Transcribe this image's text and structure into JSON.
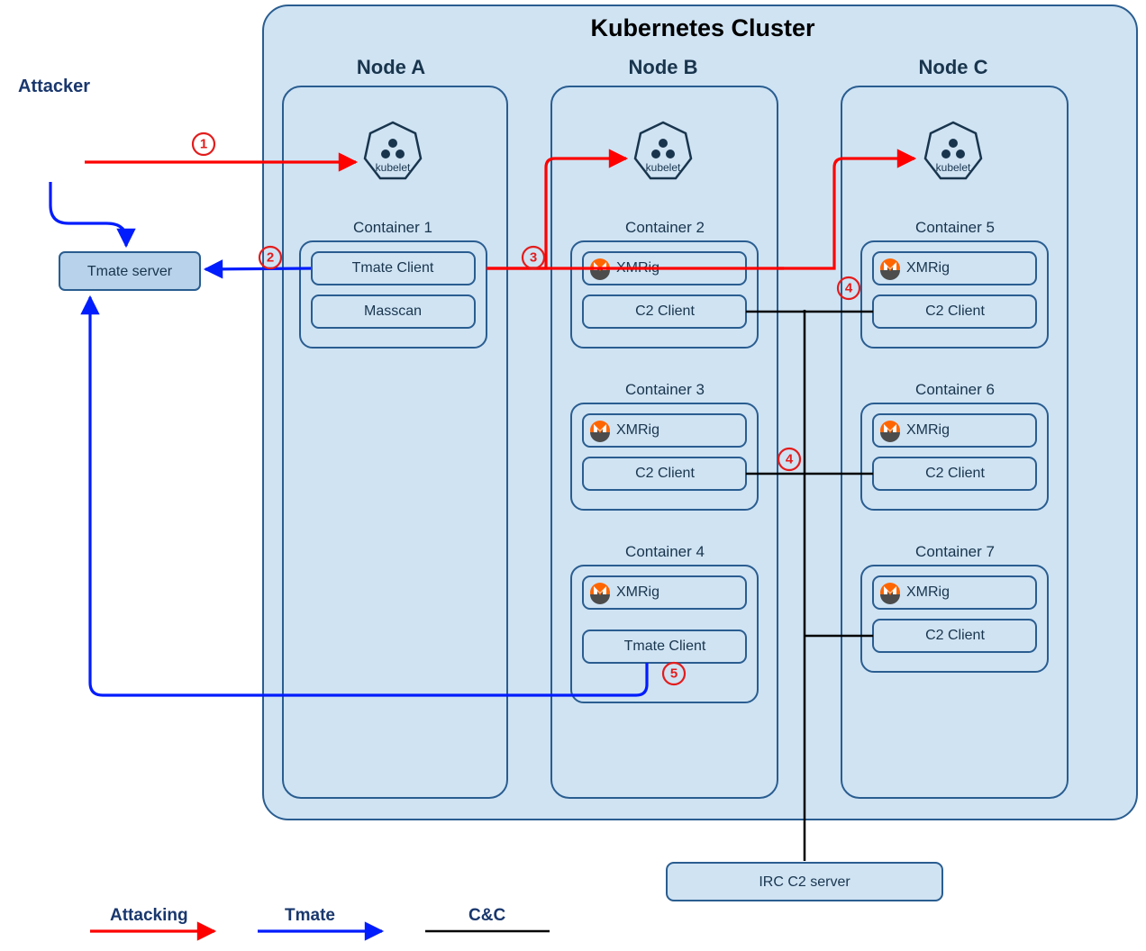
{
  "attacker": "Attacker",
  "cluster": {
    "title": "Kubernetes Cluster"
  },
  "kubelet_label": "kubelet",
  "tmate_server": "Tmate server",
  "irc_server": "IRC C2 server",
  "nodes": {
    "a": {
      "title": "Node A",
      "containers": [
        {
          "title": "Container 1",
          "items": [
            "Tmate Client",
            "Masscan"
          ]
        }
      ]
    },
    "b": {
      "title": "Node B",
      "containers": [
        {
          "title": "Container 2",
          "items": [
            "XMRig",
            "C2 Client"
          ]
        },
        {
          "title": "Container 3",
          "items": [
            "XMRig",
            "C2 Client"
          ]
        },
        {
          "title": "Container 4",
          "items": [
            "XMRig",
            "Tmate Client"
          ]
        }
      ]
    },
    "c": {
      "title": "Node C",
      "containers": [
        {
          "title": "Container 5",
          "items": [
            "XMRig",
            "C2 Client"
          ]
        },
        {
          "title": "Container 6",
          "items": [
            "XMRig",
            "C2 Client"
          ]
        },
        {
          "title": "Container 7",
          "items": [
            "XMRig",
            "C2 Client"
          ]
        }
      ]
    }
  },
  "steps": {
    "1": "1",
    "2": "2",
    "3": "3",
    "4a": "4",
    "4b": "4",
    "5": "5"
  },
  "legend": {
    "attacking": "Attacking",
    "tmate": "Tmate",
    "cc": "C&C"
  },
  "colors": {
    "attack": "#fd0100",
    "tmate": "#011cfd",
    "cc": "#000000",
    "panel": "#cfe3f3",
    "border": "#2a5d90"
  }
}
